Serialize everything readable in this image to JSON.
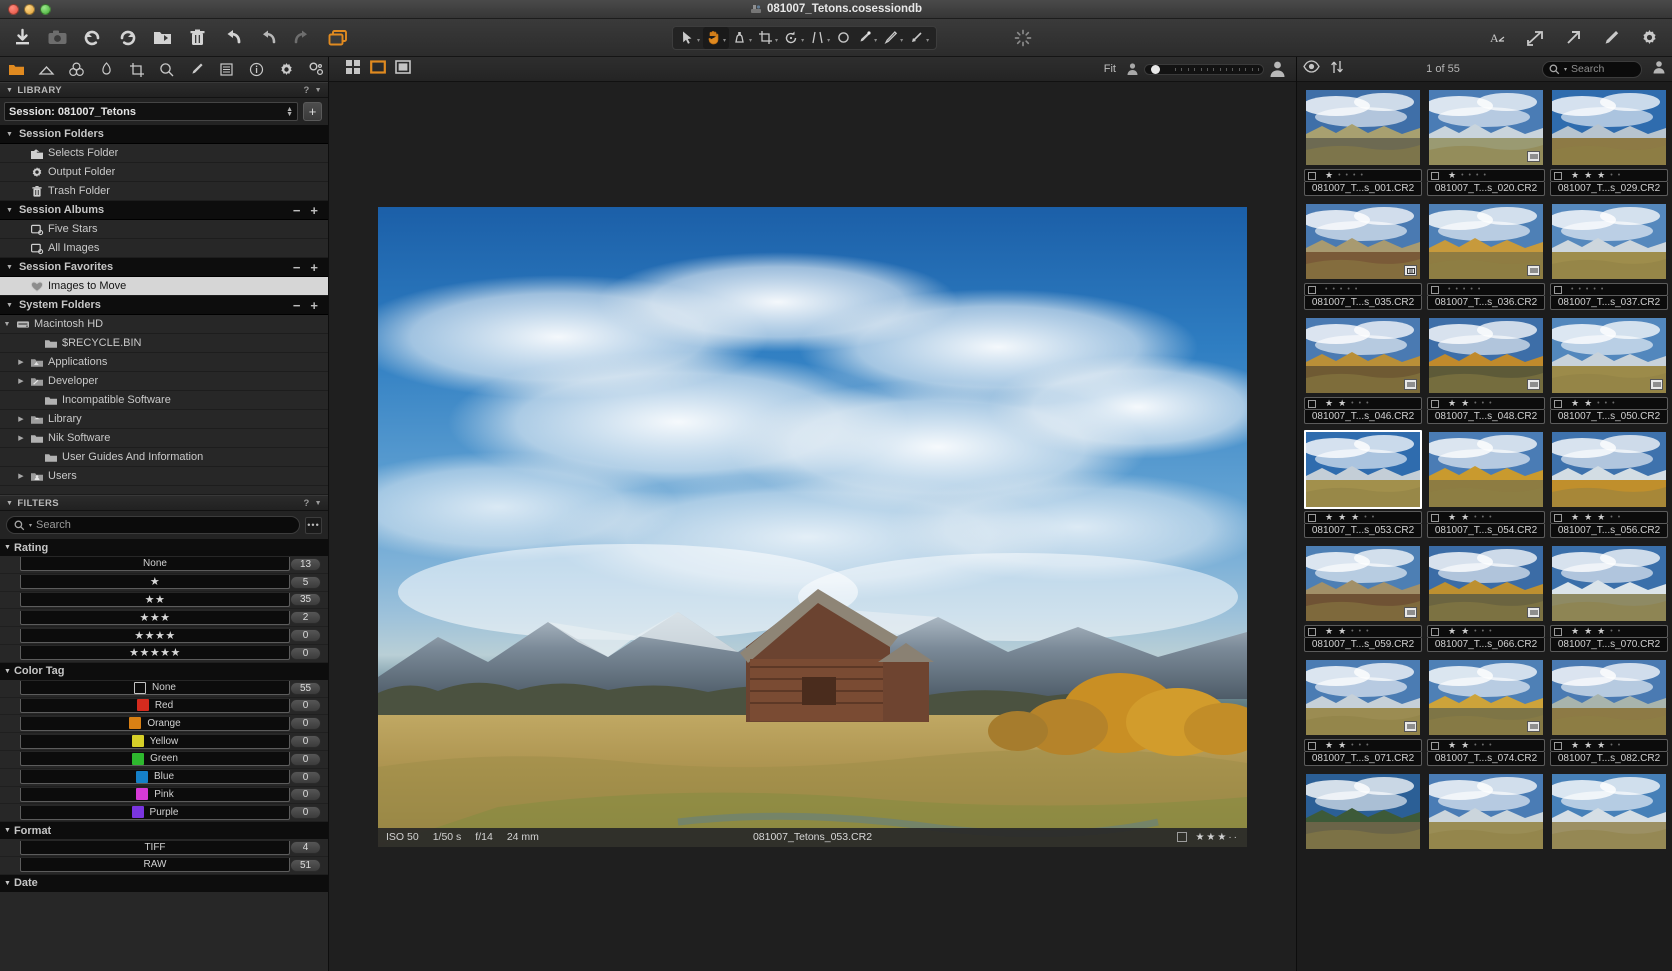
{
  "window": {
    "title": "081007_Tetons.cosessiondb",
    "title_icon": "capture-one-session-icon"
  },
  "toolbar": {
    "left_buttons": [
      {
        "name": "import-images-button",
        "icon": "download-arrow-icon",
        "label": "Import Images"
      },
      {
        "name": "capture-button",
        "icon": "camera-icon",
        "label": "Capture"
      },
      {
        "name": "rotate-left-button",
        "icon": "rotate-ccw-icon",
        "label": "Rotate Counterclockwise"
      },
      {
        "name": "rotate-right-button",
        "icon": "rotate-cw-icon",
        "label": "Rotate Clockwise"
      },
      {
        "name": "move-to-folder-button",
        "icon": "folder-arrow-icon",
        "label": "Move to Folder"
      },
      {
        "name": "delete-button",
        "icon": "trash-icon",
        "label": "Delete"
      },
      {
        "name": "reset-button",
        "icon": "reset-arrow-icon",
        "label": "Reset"
      },
      {
        "name": "undo-button",
        "icon": "undo-arrow-icon",
        "label": "Undo"
      },
      {
        "name": "redo-button",
        "icon": "redo-arrow-icon",
        "label": "Redo"
      },
      {
        "name": "viewer-layout-button",
        "icon": "stacked-windows-icon",
        "label": "Viewer"
      }
    ],
    "tools": [
      {
        "name": "select-tool",
        "icon": "cursor-arrow-icon",
        "label": "Pan/Select",
        "active": false,
        "has_menu": true
      },
      {
        "name": "pan-tool",
        "icon": "hand-icon",
        "label": "Pan",
        "active": true,
        "has_menu": true
      },
      {
        "name": "white-balance-tool",
        "icon": "white-balance-picker-icon",
        "label": "White Balance",
        "active": false,
        "has_menu": true
      },
      {
        "name": "crop-tool",
        "icon": "crop-icon",
        "label": "Crop",
        "active": false,
        "has_menu": true
      },
      {
        "name": "rotate-tool",
        "icon": "rotate-angle-icon",
        "label": "Rotate",
        "active": false,
        "has_menu": true
      },
      {
        "name": "keystone-tool",
        "icon": "keystone-icon",
        "label": "Keystone",
        "active": false,
        "has_menu": true
      },
      {
        "name": "spot-removal-tool",
        "icon": "circle-spot-icon",
        "label": "Spot Removal",
        "active": false,
        "has_menu": false
      },
      {
        "name": "draw-mask-tool",
        "icon": "brush-icon",
        "label": "Draw Mask",
        "active": false,
        "has_menu": true
      },
      {
        "name": "erase-mask-tool",
        "icon": "eraser-icon",
        "label": "Erase Mask",
        "active": false,
        "has_menu": true
      },
      {
        "name": "gradient-mask-tool",
        "icon": "gradient-arrow-icon",
        "label": "Gradient Mask",
        "active": false,
        "has_menu": true
      }
    ],
    "processing_spinner": {
      "name": "processing-spinner-icon",
      "label": "Processing"
    },
    "right_buttons": [
      {
        "name": "font-style-button",
        "icon": "letter-a-icon",
        "label": "Annotations"
      },
      {
        "name": "export-button",
        "icon": "export-arrow-icon",
        "label": "Export"
      },
      {
        "name": "share-button",
        "icon": "share-arrow-icon",
        "label": "Share"
      },
      {
        "name": "edit-with-button",
        "icon": "pencil-icon",
        "label": "Edit With"
      },
      {
        "name": "preferences-button",
        "icon": "gear-icon",
        "label": "Preferences"
      }
    ]
  },
  "sidebar": {
    "tabs": [
      {
        "name": "tab-library",
        "icon": "folder-icon",
        "active": true
      },
      {
        "name": "tab-capture",
        "icon": "tent-icon",
        "active": false
      },
      {
        "name": "tab-color",
        "icon": "three-circles-icon",
        "active": false
      },
      {
        "name": "tab-exposure",
        "icon": "leaf-aperture-icon",
        "active": false
      },
      {
        "name": "tab-lens",
        "icon": "crop-icon",
        "active": false
      },
      {
        "name": "tab-details",
        "icon": "magnifier-icon",
        "active": false
      },
      {
        "name": "tab-adjustments",
        "icon": "brush-icon",
        "active": false
      },
      {
        "name": "tab-metadata",
        "icon": "list-lines-icon",
        "active": false
      },
      {
        "name": "tab-info",
        "icon": "info-circle-icon",
        "active": false
      },
      {
        "name": "tab-output",
        "icon": "gear-icon",
        "active": false
      },
      {
        "name": "tab-batch",
        "icon": "gears-icon",
        "active": false
      }
    ],
    "library": {
      "header": "LIBRARY",
      "help": "?",
      "session_label": "Session: 081007_Tetons",
      "add_button": "+",
      "groups": [
        {
          "name": "session-folders",
          "label": "Session Folders",
          "has_addremove": false,
          "items": [
            {
              "label": "Selects Folder",
              "icon": "selects-folder-icon",
              "indent": 1,
              "disclosure": false
            },
            {
              "label": "Output Folder",
              "icon": "gear-folder-icon",
              "indent": 1,
              "disclosure": false
            },
            {
              "label": "Trash Folder",
              "icon": "trash-icon",
              "indent": 1,
              "disclosure": false
            }
          ]
        },
        {
          "name": "session-albums",
          "label": "Session Albums",
          "has_addremove": true,
          "items": [
            {
              "label": "Five Stars",
              "icon": "album-icon",
              "indent": 1,
              "disclosure": false
            },
            {
              "label": "All Images",
              "icon": "album-icon",
              "indent": 1,
              "disclosure": false
            }
          ]
        },
        {
          "name": "session-favorites",
          "label": "Session Favorites",
          "has_addremove": true,
          "items": [
            {
              "label": "Images to Move",
              "icon": "heart-icon",
              "indent": 1,
              "disclosure": false,
              "selected": true
            }
          ]
        },
        {
          "name": "system-folders",
          "label": "System Folders",
          "has_addremove": true,
          "items": [
            {
              "label": "Macintosh HD",
              "icon": "hard-drive-icon",
              "indent": 0,
              "disclosure": "open"
            },
            {
              "label": "$RECYCLE.BIN",
              "icon": "folder-plain-icon",
              "indent": 2,
              "disclosure": false
            },
            {
              "label": "Applications",
              "icon": "applications-folder-icon",
              "indent": 1,
              "disclosure": "closed"
            },
            {
              "label": "Developer",
              "icon": "developer-folder-icon",
              "indent": 1,
              "disclosure": "closed"
            },
            {
              "label": "Incompatible Software",
              "icon": "folder-plain-icon",
              "indent": 2,
              "disclosure": false
            },
            {
              "label": "Library",
              "icon": "library-folder-icon",
              "indent": 1,
              "disclosure": "closed"
            },
            {
              "label": "Nik Software",
              "icon": "folder-plain-icon",
              "indent": 1,
              "disclosure": "closed"
            },
            {
              "label": "User Guides And Information",
              "icon": "folder-plain-icon",
              "indent": 2,
              "disclosure": false
            },
            {
              "label": "Users",
              "icon": "users-folder-icon",
              "indent": 1,
              "disclosure": "closed"
            }
          ]
        }
      ]
    },
    "filters": {
      "header": "FILTERS",
      "help": "?",
      "search_placeholder": "Search",
      "search_value": "",
      "more_button": "•••",
      "sections": [
        {
          "name": "rating",
          "label": "Rating",
          "rows": [
            {
              "label": "None",
              "stars": 0,
              "count": "13"
            },
            {
              "label": "",
              "stars": 1,
              "count": "5"
            },
            {
              "label": "",
              "stars": 2,
              "count": "35"
            },
            {
              "label": "",
              "stars": 3,
              "count": "2"
            },
            {
              "label": "",
              "stars": 4,
              "count": "0"
            },
            {
              "label": "",
              "stars": 5,
              "count": "0"
            }
          ]
        },
        {
          "name": "color-tag",
          "label": "Color Tag",
          "rows": [
            {
              "label": "None",
              "color": "none",
              "count": "55"
            },
            {
              "label": "Red",
              "color": "#d52b1e",
              "count": "0"
            },
            {
              "label": "Orange",
              "color": "#d98014",
              "count": "0"
            },
            {
              "label": "Yellow",
              "color": "#d6cf28",
              "count": "0"
            },
            {
              "label": "Green",
              "color": "#2eb82e",
              "count": "0"
            },
            {
              "label": "Blue",
              "color": "#1580c8",
              "count": "0"
            },
            {
              "label": "Pink",
              "color": "#d63ad6",
              "count": "0"
            },
            {
              "label": "Purple",
              "color": "#7a35e0",
              "count": "0"
            }
          ]
        },
        {
          "name": "format",
          "label": "Format",
          "rows": [
            {
              "label": "TIFF",
              "count": "4"
            },
            {
              "label": "RAW",
              "count": "51"
            }
          ]
        },
        {
          "name": "date",
          "label": "Date",
          "rows": []
        }
      ]
    }
  },
  "viewer": {
    "view_modes": [
      {
        "name": "grid-view-button",
        "icon": "grid-four-squares-icon",
        "active": false
      },
      {
        "name": "single-view-button",
        "icon": "single-square-icon",
        "active": true
      },
      {
        "name": "proof-view-button",
        "icon": "framed-square-icon",
        "active": false
      }
    ],
    "fit_label": "Fit",
    "zoom_small_icon": "person-small-icon",
    "zoom_large_icon": "person-large-icon",
    "zoom_value": 0,
    "image": {
      "iso": "ISO 50",
      "shutter": "1/50 s",
      "aperture": "f/14",
      "focal": "24 mm",
      "filename": "081007_Tetons_053.CR2",
      "rating_stars": 3,
      "rating_max": 5
    }
  },
  "browser": {
    "eye_icon": "eye-icon",
    "sort_icon": "sort-arrows-icon",
    "count_label": "1 of 55",
    "search_placeholder": "Search",
    "search_value": "",
    "user_icon": "person-icon",
    "thumbnails": [
      {
        "filename": "081007_T...s_001.CR2",
        "stars": 1,
        "badge": "",
        "selected": false,
        "scene": "sign"
      },
      {
        "filename": "081007_T...s_020.CR2",
        "stars": 1,
        "badge": "list",
        "selected": false,
        "scene": "peaks"
      },
      {
        "filename": "081007_T...s_029.CR2",
        "stars": 3,
        "badge": "",
        "selected": false,
        "scene": "barn-wide"
      },
      {
        "filename": "081007_T...s_035.CR2",
        "stars": 0,
        "badge": "crop",
        "selected": false,
        "scene": "barn-brown"
      },
      {
        "filename": "081007_T...s_036.CR2",
        "stars": 0,
        "badge": "list",
        "selected": false,
        "scene": "barn-fall"
      },
      {
        "filename": "081007_T...s_037.CR2",
        "stars": 0,
        "badge": "",
        "selected": false,
        "scene": "field"
      },
      {
        "filename": "081007_T...s_046.CR2",
        "stars": 2,
        "badge": "list",
        "selected": false,
        "scene": "barn-tall"
      },
      {
        "filename": "081007_T...s_048.CR2",
        "stars": 2,
        "badge": "list",
        "selected": false,
        "scene": "bush"
      },
      {
        "filename": "081007_T...s_050.CR2",
        "stars": 2,
        "badge": "list",
        "selected": false,
        "scene": "barn-small"
      },
      {
        "filename": "081007_T...s_053.CR2",
        "stars": 3,
        "badge": "",
        "selected": true,
        "scene": "main"
      },
      {
        "filename": "081007_T...s_054.CR2",
        "stars": 2,
        "badge": "",
        "selected": false,
        "scene": "trees-gold"
      },
      {
        "filename": "081007_T...s_056.CR2",
        "stars": 3,
        "badge": "",
        "selected": false,
        "scene": "peaks-gold"
      },
      {
        "filename": "081007_T...s_059.CR2",
        "stars": 2,
        "badge": "list",
        "selected": false,
        "scene": "barn-brown2"
      },
      {
        "filename": "081007_T...s_066.CR2",
        "stars": 2,
        "badge": "list",
        "selected": false,
        "scene": "tall-tree"
      },
      {
        "filename": "081007_T...s_070.CR2",
        "stars": 3,
        "badge": "",
        "selected": false,
        "scene": "snow-peaks"
      },
      {
        "filename": "081007_T...s_071.CR2",
        "stars": 2,
        "badge": "list",
        "selected": false,
        "scene": "range"
      },
      {
        "filename": "081007_T...s_074.CR2",
        "stars": 2,
        "badge": "list",
        "selected": false,
        "scene": "aspen"
      },
      {
        "filename": "081007_T...s_082.CR2",
        "stars": 3,
        "badge": "",
        "selected": false,
        "scene": "river"
      },
      {
        "filename": "",
        "stars": 0,
        "badge": "",
        "selected": false,
        "scene": "pine"
      },
      {
        "filename": "",
        "stars": 0,
        "badge": "",
        "selected": false,
        "scene": "valley"
      },
      {
        "filename": "",
        "stars": 0,
        "badge": "",
        "selected": false,
        "scene": "mountain"
      }
    ]
  }
}
